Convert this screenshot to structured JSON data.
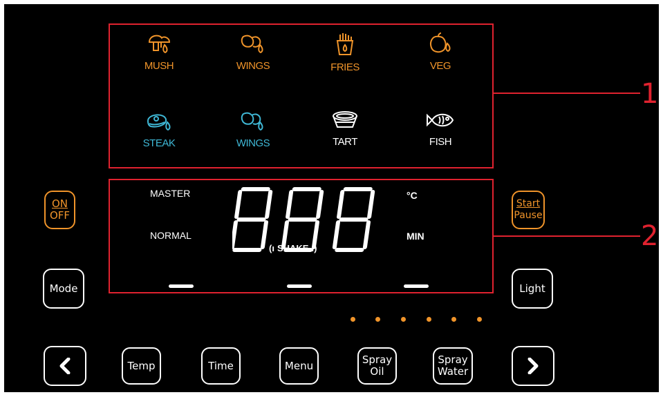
{
  "programs": [
    {
      "label": "MUSH",
      "icon": "mushroom-icon",
      "color": "#f0942a"
    },
    {
      "label": "WINGS",
      "icon": "chicken-wings-icon",
      "color": "#f0942a"
    },
    {
      "label": "FRIES",
      "icon": "fries-icon",
      "color": "#f0942a"
    },
    {
      "label": "VEG",
      "icon": "vegetable-icon",
      "color": "#f0942a"
    },
    {
      "label": "STEAK",
      "icon": "steak-icon",
      "color": "#3fb8d6"
    },
    {
      "label": "WINGS",
      "icon": "chicken-wings-icon",
      "color": "#3fb8d6"
    },
    {
      "label": "TART",
      "icon": "tart-icon",
      "color": "#ffffff"
    },
    {
      "label": "FISH",
      "icon": "fish-icon",
      "color": "#ffffff"
    }
  ],
  "display": {
    "master": "MASTER",
    "normal": "NORMAL",
    "digits": "888",
    "celsius": "°C",
    "min": "MIN",
    "shake": "SHAKE"
  },
  "buttons": {
    "on": "ON",
    "off": "OFF",
    "start": "Start",
    "pause": "Pause",
    "mode": "Mode",
    "light": "Light",
    "temp": "Temp",
    "time": "Time",
    "menu": "Menu",
    "spray_oil_1": "Spray",
    "spray_oil_2": "Oil",
    "spray_water_1": "Spray",
    "spray_water_2": "Water"
  },
  "callouts": [
    "1",
    "2"
  ],
  "colors": {
    "accent": "#f0942a",
    "highlight": "#3fb8d6",
    "callout": "#e0222f"
  }
}
